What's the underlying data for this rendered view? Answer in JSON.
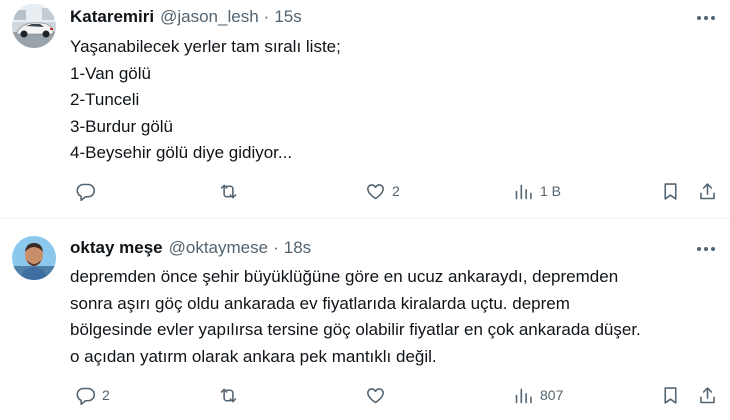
{
  "tweets": [
    {
      "display_name": "Kataremiri",
      "handle": "@jason_lesh",
      "separator": "·",
      "time": "15s",
      "lines": [
        "Yaşanabilecek yerler tam sıralı liste;",
        "1-Van gölü",
        "2-Tunceli",
        "3-Burdur gölü",
        "4-Beysehir gölü diye gidiyor..."
      ],
      "reply_count": "",
      "retweet_count": "",
      "like_count": "2",
      "view_count": "1 B"
    },
    {
      "display_name": "oktay meşe",
      "handle": "@oktaymese",
      "separator": "·",
      "time": "18s",
      "lines": [
        "depremden önce şehir büyüklüğüne göre en ucuz ankaraydı, depremden",
        "sonra aşırı göç oldu ankarada ev fiyatlarıda kiralarda uçtu. deprem",
        "bölgesinde evler yapılırsa tersine göç olabilir fiyatlar en çok ankarada düşer.",
        "o açıdan yatırm olarak ankara pek mantıklı değil."
      ],
      "reply_count": "2",
      "retweet_count": "",
      "like_count": "",
      "view_count": "807"
    }
  ],
  "icons": {
    "reply": "reply-icon",
    "retweet": "retweet-icon",
    "like": "heart-icon",
    "views": "views-icon",
    "bookmark": "bookmark-icon",
    "share": "share-icon",
    "more": "more-icon"
  },
  "colors": {
    "text": "#0f1419",
    "secondary": "#536471",
    "divider": "#eff3f4"
  }
}
